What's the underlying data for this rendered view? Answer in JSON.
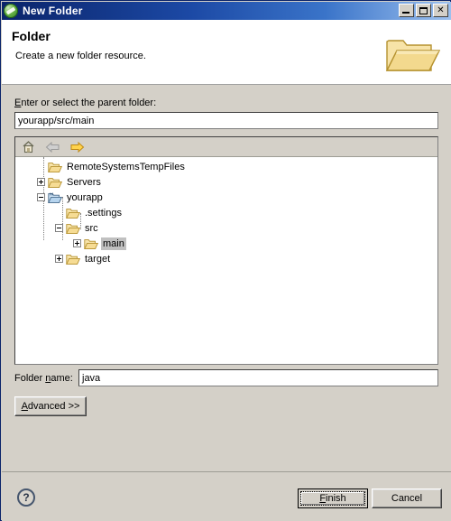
{
  "window": {
    "title": "New Folder",
    "title_icon": "eclipse-wizard-icon",
    "controls": {
      "minimize": "minimize-icon",
      "maximize": "maximize-icon",
      "close": "✕"
    }
  },
  "header": {
    "title": "Folder",
    "description": "Create a new folder resource.",
    "banner_icon": "open-folder-icon"
  },
  "parent_folder": {
    "label_pre": "E",
    "label_post": "nter or select the parent folder:",
    "value": "yourapp/src/main",
    "placeholder": ""
  },
  "tree_toolbar": {
    "home": "home-icon",
    "back": "back-arrow-icon",
    "forward": "forward-arrow-icon"
  },
  "tree": [
    {
      "label": "RemoteSystemsTempFiles",
      "depth": 0,
      "expander": "none",
      "icon": "folder-icon",
      "selected": false
    },
    {
      "label": "Servers",
      "depth": 0,
      "expander": "plus",
      "icon": "folder-icon",
      "selected": false
    },
    {
      "label": "yourapp",
      "depth": 0,
      "expander": "minus",
      "icon": "project-icon",
      "selected": false
    },
    {
      "label": ".settings",
      "depth": 1,
      "expander": "none",
      "icon": "folder-icon",
      "selected": false
    },
    {
      "label": "src",
      "depth": 1,
      "expander": "minus",
      "icon": "folder-icon",
      "selected": false
    },
    {
      "label": "main",
      "depth": 2,
      "expander": "plus",
      "icon": "folder-icon",
      "selected": true
    },
    {
      "label": "target",
      "depth": 1,
      "expander": "plus",
      "icon": "folder-icon",
      "selected": false
    }
  ],
  "folder_name": {
    "label_pre": "Folder ",
    "label_mn": "n",
    "label_post": "ame:",
    "value": "java",
    "placeholder": ""
  },
  "advanced": {
    "label_mn": "A",
    "label_post": "dvanced >>"
  },
  "footer": {
    "help": "?",
    "finish_mn": "F",
    "finish_post": "inish",
    "cancel": "Cancel"
  },
  "colors": {
    "title_bar_start": "#0a246a",
    "title_bar_end": "#9cc0ee",
    "dialog_bg": "#d4d0c8",
    "panel_bg": "#ffffff",
    "selection_bg": "#c0c0c0",
    "folder_fill": "#f5dc9a",
    "folder_stroke": "#b08d35"
  }
}
